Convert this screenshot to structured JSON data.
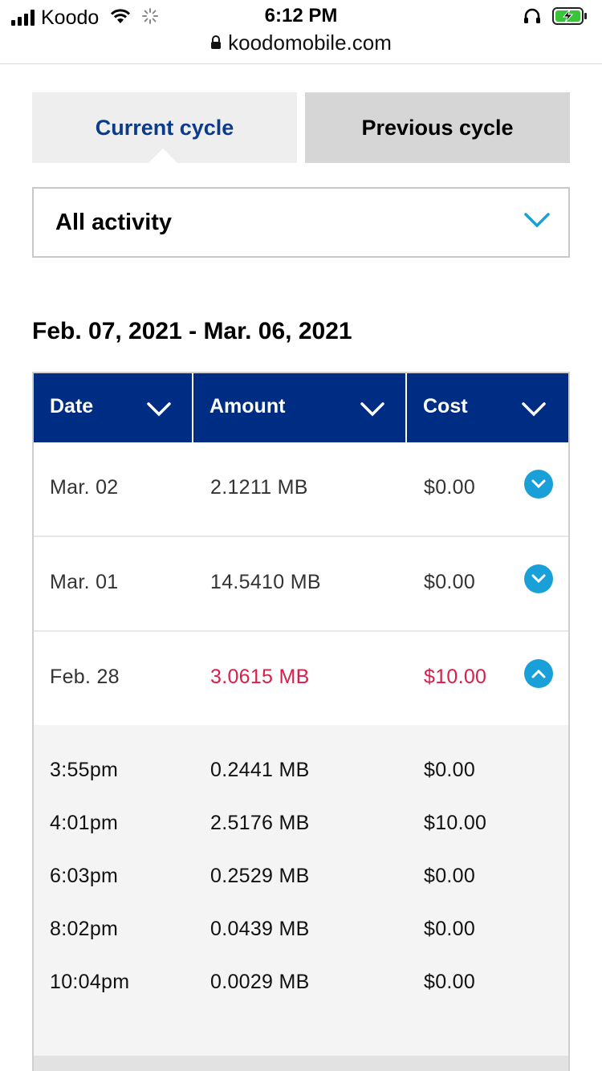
{
  "status_bar": {
    "carrier": "Koodo",
    "time": "6:12 PM",
    "url": "koodomobile.com"
  },
  "tabs": [
    {
      "label": "Current cycle",
      "selected": true
    },
    {
      "label": "Previous cycle",
      "selected": false
    }
  ],
  "filter": {
    "selected": "All activity"
  },
  "period": "Feb. 07, 2021 - Mar. 06, 2021",
  "table": {
    "headers": [
      "Date",
      "Amount",
      "Cost"
    ],
    "rows": [
      {
        "date": "Mar. 02",
        "amount": "2.1211 MB",
        "cost": "$0.00",
        "expanded": false
      },
      {
        "date": "Mar. 01",
        "amount": "14.5410 MB",
        "cost": "$0.00",
        "expanded": false
      },
      {
        "date": "Feb. 28",
        "amount": "3.0615 MB",
        "cost": "$10.00",
        "expanded": true
      }
    ],
    "details": [
      {
        "time": "3:55pm",
        "amount": "0.2441 MB",
        "cost": "$0.00"
      },
      {
        "time": "4:01pm",
        "amount": "2.5176 MB",
        "cost": "$10.00"
      },
      {
        "time": "6:03pm",
        "amount": "0.2529 MB",
        "cost": "$0.00"
      },
      {
        "time": "8:02pm",
        "amount": "0.0439 MB",
        "cost": "$0.00"
      },
      {
        "time": "10:04pm",
        "amount": "0.0029 MB",
        "cost": "$0.00"
      }
    ]
  },
  "colors": {
    "brand_blue": "#002d84",
    "tab_text": "#0a3b8c",
    "accent": "#1aa0d8",
    "overage_red": "#d6204b",
    "battery_green": "#3ac43a"
  },
  "icons": [
    "signal-icon",
    "wifi-icon",
    "activity-spinner-icon",
    "lock-icon",
    "headphones-icon",
    "battery-charging-icon",
    "chevron-down-icon",
    "chevron-up-icon"
  ]
}
